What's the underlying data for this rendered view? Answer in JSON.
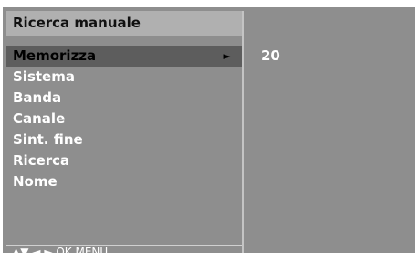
{
  "title": "Ricerca manuale",
  "menu": {
    "items": [
      {
        "label": "Memorizza",
        "selected": true,
        "arrow": "►"
      },
      {
        "label": "Sistema"
      },
      {
        "label": "Banda"
      },
      {
        "label": "Canale"
      },
      {
        "label": "Sint. fine"
      },
      {
        "label": "Ricerca"
      },
      {
        "label": "Nome"
      }
    ]
  },
  "value_panel": {
    "value": "20"
  },
  "footer": {
    "hint": "▲▼  ◄ ►  OK  MENU"
  },
  "colors": {
    "panel_background": "#8e8e8e",
    "title_background": "#b0b0b0",
    "selected_background": "#5d5d5d",
    "text_normal": "#ffffff",
    "text_selected": "#000000"
  }
}
